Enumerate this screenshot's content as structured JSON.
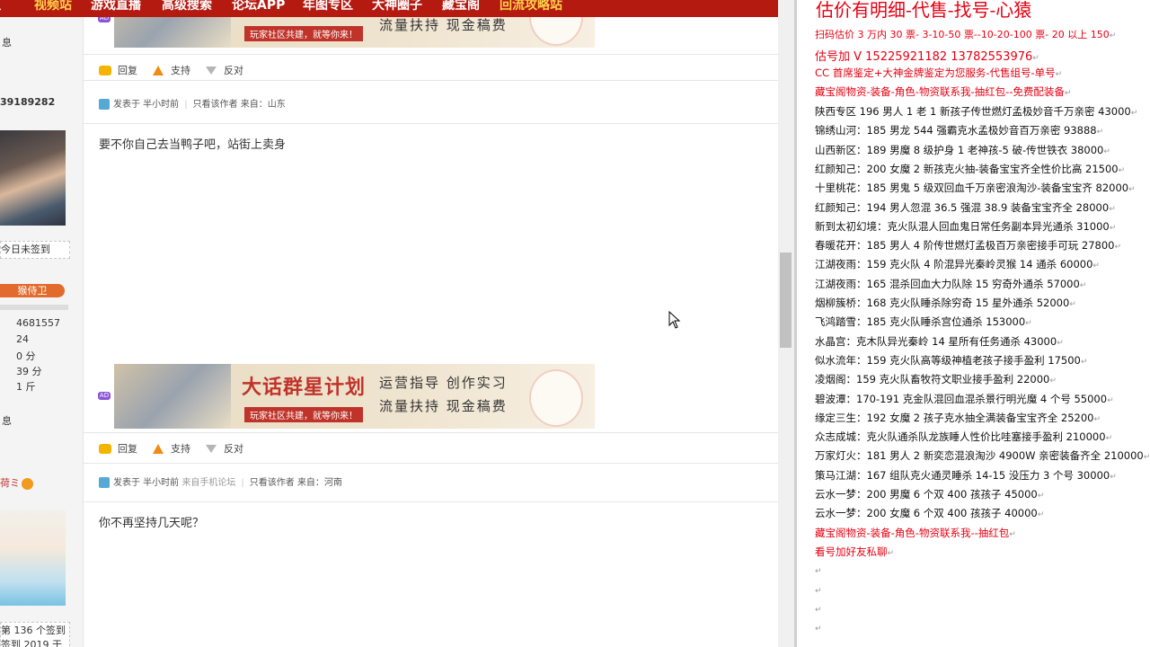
{
  "nav": {
    "items": [
      {
        "label": "贝",
        "highlight": false
      },
      {
        "label": "视频站",
        "highlight": true
      },
      {
        "label": "游戏直播",
        "highlight": false
      },
      {
        "label": "高级搜索",
        "highlight": false
      },
      {
        "label": "论坛APP",
        "highlight": false
      },
      {
        "label": "年图专区",
        "highlight": false
      },
      {
        "label": "大神圈子",
        "highlight": false
      },
      {
        "label": "藏宝阁",
        "highlight": false
      },
      {
        "label": "回流攻略站",
        "highlight": true
      }
    ]
  },
  "sidebar": {
    "u1_info": "息",
    "u1_uid": "39189282",
    "u1_sign": "今日未签到",
    "u1_badge": "猴侍卫",
    "u1_stats": [
      "4681557",
      "24",
      "0 分",
      "39 分",
      "1 斤"
    ],
    "u2_info": "息",
    "u2_name": "荷ミ",
    "u2_sign1": "第 136 个签到",
    "u2_sign2": "签到 2019 于"
  },
  "banner": {
    "title": "大话群星计划",
    "sub": "玩家社区共建，就等你来！",
    "line1": "运营指导  创作实习",
    "line2": "流量扶持  现金稿费",
    "ad_tag": "AD"
  },
  "actions": {
    "reply": "回复",
    "support": "支持",
    "oppose": "反对"
  },
  "posts": [
    {
      "time": "发表于 半小时前",
      "source": "",
      "only_author": "只看该作者",
      "from": "来自：山东",
      "content": "要不你自己去当鸭子吧，站街上卖身"
    },
    {
      "time": "发表于 半小时前",
      "source": "来自手机论坛",
      "only_author": "只看该作者",
      "from": "来自：河南",
      "content": "你不再坚持几天呢？"
    }
  ],
  "right_panel": {
    "title": "估价有明细-代售-找号-心猿",
    "lines": [
      {
        "text": "扫码估价 3 万内 30 票- 3-10-50 票--10-20-100 票- 20 以上 150",
        "color": "red"
      },
      {
        "text": "估号加 V 15225921182   13782553976",
        "color": "red"
      },
      {
        "text": "CC 首席鉴定+大神金牌鉴定为您服务-代售组号-单号",
        "color": "red"
      },
      {
        "text": "藏宝阁物资-装备-角色-物资联系我-抽红包--免费配装备",
        "color": "red"
      },
      {
        "text": "陕西专区 196 男人 1 老 1 新孩子传世燃灯孟极妙音千万亲密 43000",
        "color": "black"
      },
      {
        "text": "锦绣山河：185 男龙 544 强霸克水孟极妙音百万亲密 93888",
        "color": "black"
      },
      {
        "text": "山西新区：189 男魔 8 级护身 1 老神孩-5 破-传世铁衣 38000",
        "color": "black"
      },
      {
        "text": "红颜知己：200 女魔 2 新孩克火抽-装备宝宝齐全性价比高 21500",
        "color": "black"
      },
      {
        "text": "十里桃花：185 男鬼 5 级双回血千万亲密浪淘沙-装备宝宝齐 82000",
        "color": "black"
      },
      {
        "text": "红颜知己：194 男人忽混 36.5 强混 38.9 装备宝宝齐全 28000",
        "color": "black"
      },
      {
        "text": "新到太初幻境：克火队混人回血鬼日常任务副本异光通杀 31000",
        "color": "black"
      },
      {
        "text": "春暖花开：185 男人 4 阶传世燃灯孟极百万亲密接手可玩 27800",
        "color": "black"
      },
      {
        "text": "江湖夜雨：159 克火队 4 阶混异光秦岭灵猴 14 通杀 60000",
        "color": "black"
      },
      {
        "text": "江湖夜雨：165 混杀回血大力队除 15 穷奇外通杀 57000",
        "color": "black"
      },
      {
        "text": "烟柳簇桥：168 克火队睡杀除穷奇 15 星外通杀 52000",
        "color": "black"
      },
      {
        "text": "飞鸿踏雪：185 克火队睡杀宫位通杀 153000",
        "color": "black"
      },
      {
        "text": "水晶宫：克木队异光秦岭 14 星所有任务通杀 43000",
        "color": "black"
      },
      {
        "text": "似水流年：159 克火队高等级神植老孩子接手盈利 17500",
        "color": "black"
      },
      {
        "text": "凌烟阁：159 克火队畜牧符文职业接手盈利 22000",
        "color": "black"
      },
      {
        "text": "碧波潭：170-191 克金队混回血混杀景行明光魔 4 个号 55000",
        "color": "black"
      },
      {
        "text": "缘定三生：192 女魔 2 孩子克水抽全满装备宝宝齐全 25200",
        "color": "black"
      },
      {
        "text": "众志成城：克火队通杀队龙族睡人性价比哇塞接手盈利 210000",
        "color": "black"
      },
      {
        "text": "万家灯火：181 男人 2 新奕恋混浪淘沙 4900W 亲密装备齐全 210000",
        "color": "black"
      },
      {
        "text": "策马江湖：167 组队克火通灵睡杀 14-15 没压力 3 个号 30000",
        "color": "black"
      },
      {
        "text": "云水一梦：200 男魔 6 个双 400 孩孩子 45000",
        "color": "black"
      },
      {
        "text": "云水一梦：200 女魔 6 个双 400 孩孩子 40000",
        "color": "black"
      },
      {
        "text": "藏宝阁物资-装备-角色-物资联系我--抽红包",
        "color": "red"
      },
      {
        "text": "看号加好友私聊",
        "color": "red"
      },
      {
        "text": "",
        "color": "black"
      },
      {
        "text": "",
        "color": "black"
      },
      {
        "text": "",
        "color": "black"
      },
      {
        "text": "",
        "color": "black"
      }
    ]
  },
  "colors": {
    "nav_bg": "#b51a11",
    "accent_red": "#e60012",
    "badge": "#e26a2c"
  }
}
